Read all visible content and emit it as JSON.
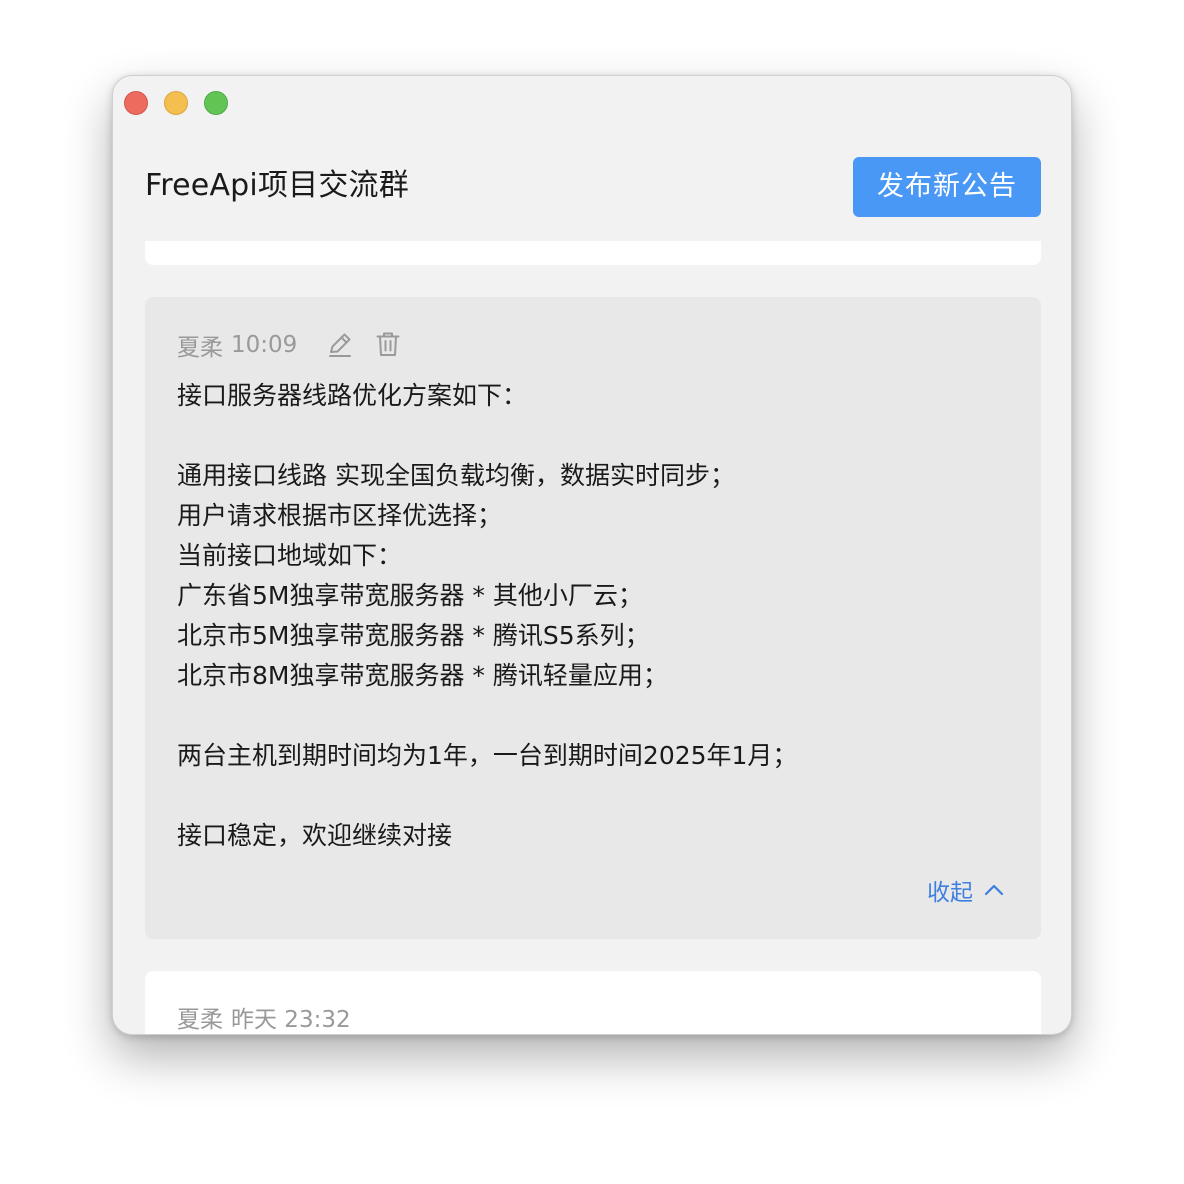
{
  "window": {
    "controls": [
      "close",
      "minimize",
      "zoom"
    ]
  },
  "header": {
    "title": "FreeApi项目交流群",
    "publish_label": "发布新公告"
  },
  "announcements": [
    {
      "author": "夏柔",
      "time": "10:09",
      "lines": [
        "接口服务器线路优化方案如下：",
        "",
        "通用接口线路 实现全国负载均衡，数据实时同步；",
        "用户请求根据市区择优选择；",
        "当前接口地域如下：",
        "广东省5M独享带宽服务器 * 其他小厂云；",
        "北京市5M独享带宽服务器 * 腾讯S5系列；",
        "北京市8M独享带宽服务器 * 腾讯轻量应用；",
        "",
        "两台主机到期时间均为1年，一台到期时间2025年1月；",
        "",
        "接口稳定，欢迎继续对接"
      ],
      "collapse_label": "收起"
    },
    {
      "author": "夏柔",
      "time": "昨天 23:32"
    }
  ],
  "colors": {
    "accent": "#4a98f5",
    "link": "#3f7fe0",
    "meta_text": "#999999",
    "active_card": "#e8e8e8",
    "window_bg": "#f2f2f2"
  },
  "icons": [
    "pencil-icon",
    "trash-icon",
    "chevron-up-icon"
  ]
}
